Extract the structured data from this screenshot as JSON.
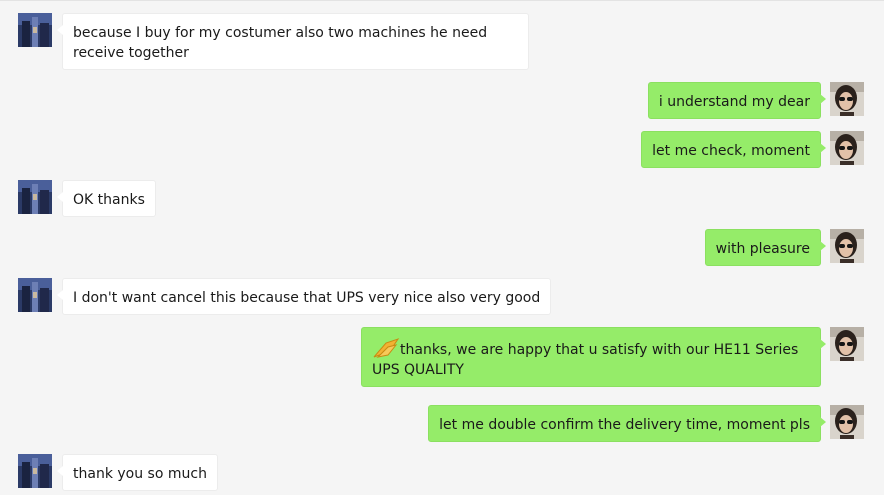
{
  "conversation": {
    "messages": [
      {
        "side": "in",
        "avatar": "customer-avatar",
        "text": "because I buy for my costumer also two machines he need receive together"
      },
      {
        "side": "out",
        "avatar": "agent-avatar",
        "text": "i understand my dear"
      },
      {
        "side": "out",
        "avatar": "agent-avatar",
        "text": "let me check, moment"
      },
      {
        "side": "in",
        "avatar": "customer-avatar",
        "text": "OK thanks"
      },
      {
        "side": "out",
        "avatar": "agent-avatar",
        "text": "with pleasure"
      },
      {
        "side": "in",
        "avatar": "customer-avatar",
        "text": "I don't want cancel this because that UPS very nice also very good"
      },
      {
        "side": "out",
        "avatar": "agent-avatar",
        "emoji": "praying-hands-emoji",
        "text": "thanks, we are happy that u satisfy with our HE11 Series UPS QUALITY"
      },
      {
        "side": "out",
        "avatar": "agent-avatar",
        "text": "let me double confirm the delivery time, moment pls"
      },
      {
        "side": "in",
        "avatar": "customer-avatar",
        "text": "thank you so much"
      }
    ]
  },
  "colors": {
    "background": "#f5f5f5",
    "incoming_bubble": "#ffffff",
    "outgoing_bubble": "#95ec69"
  }
}
